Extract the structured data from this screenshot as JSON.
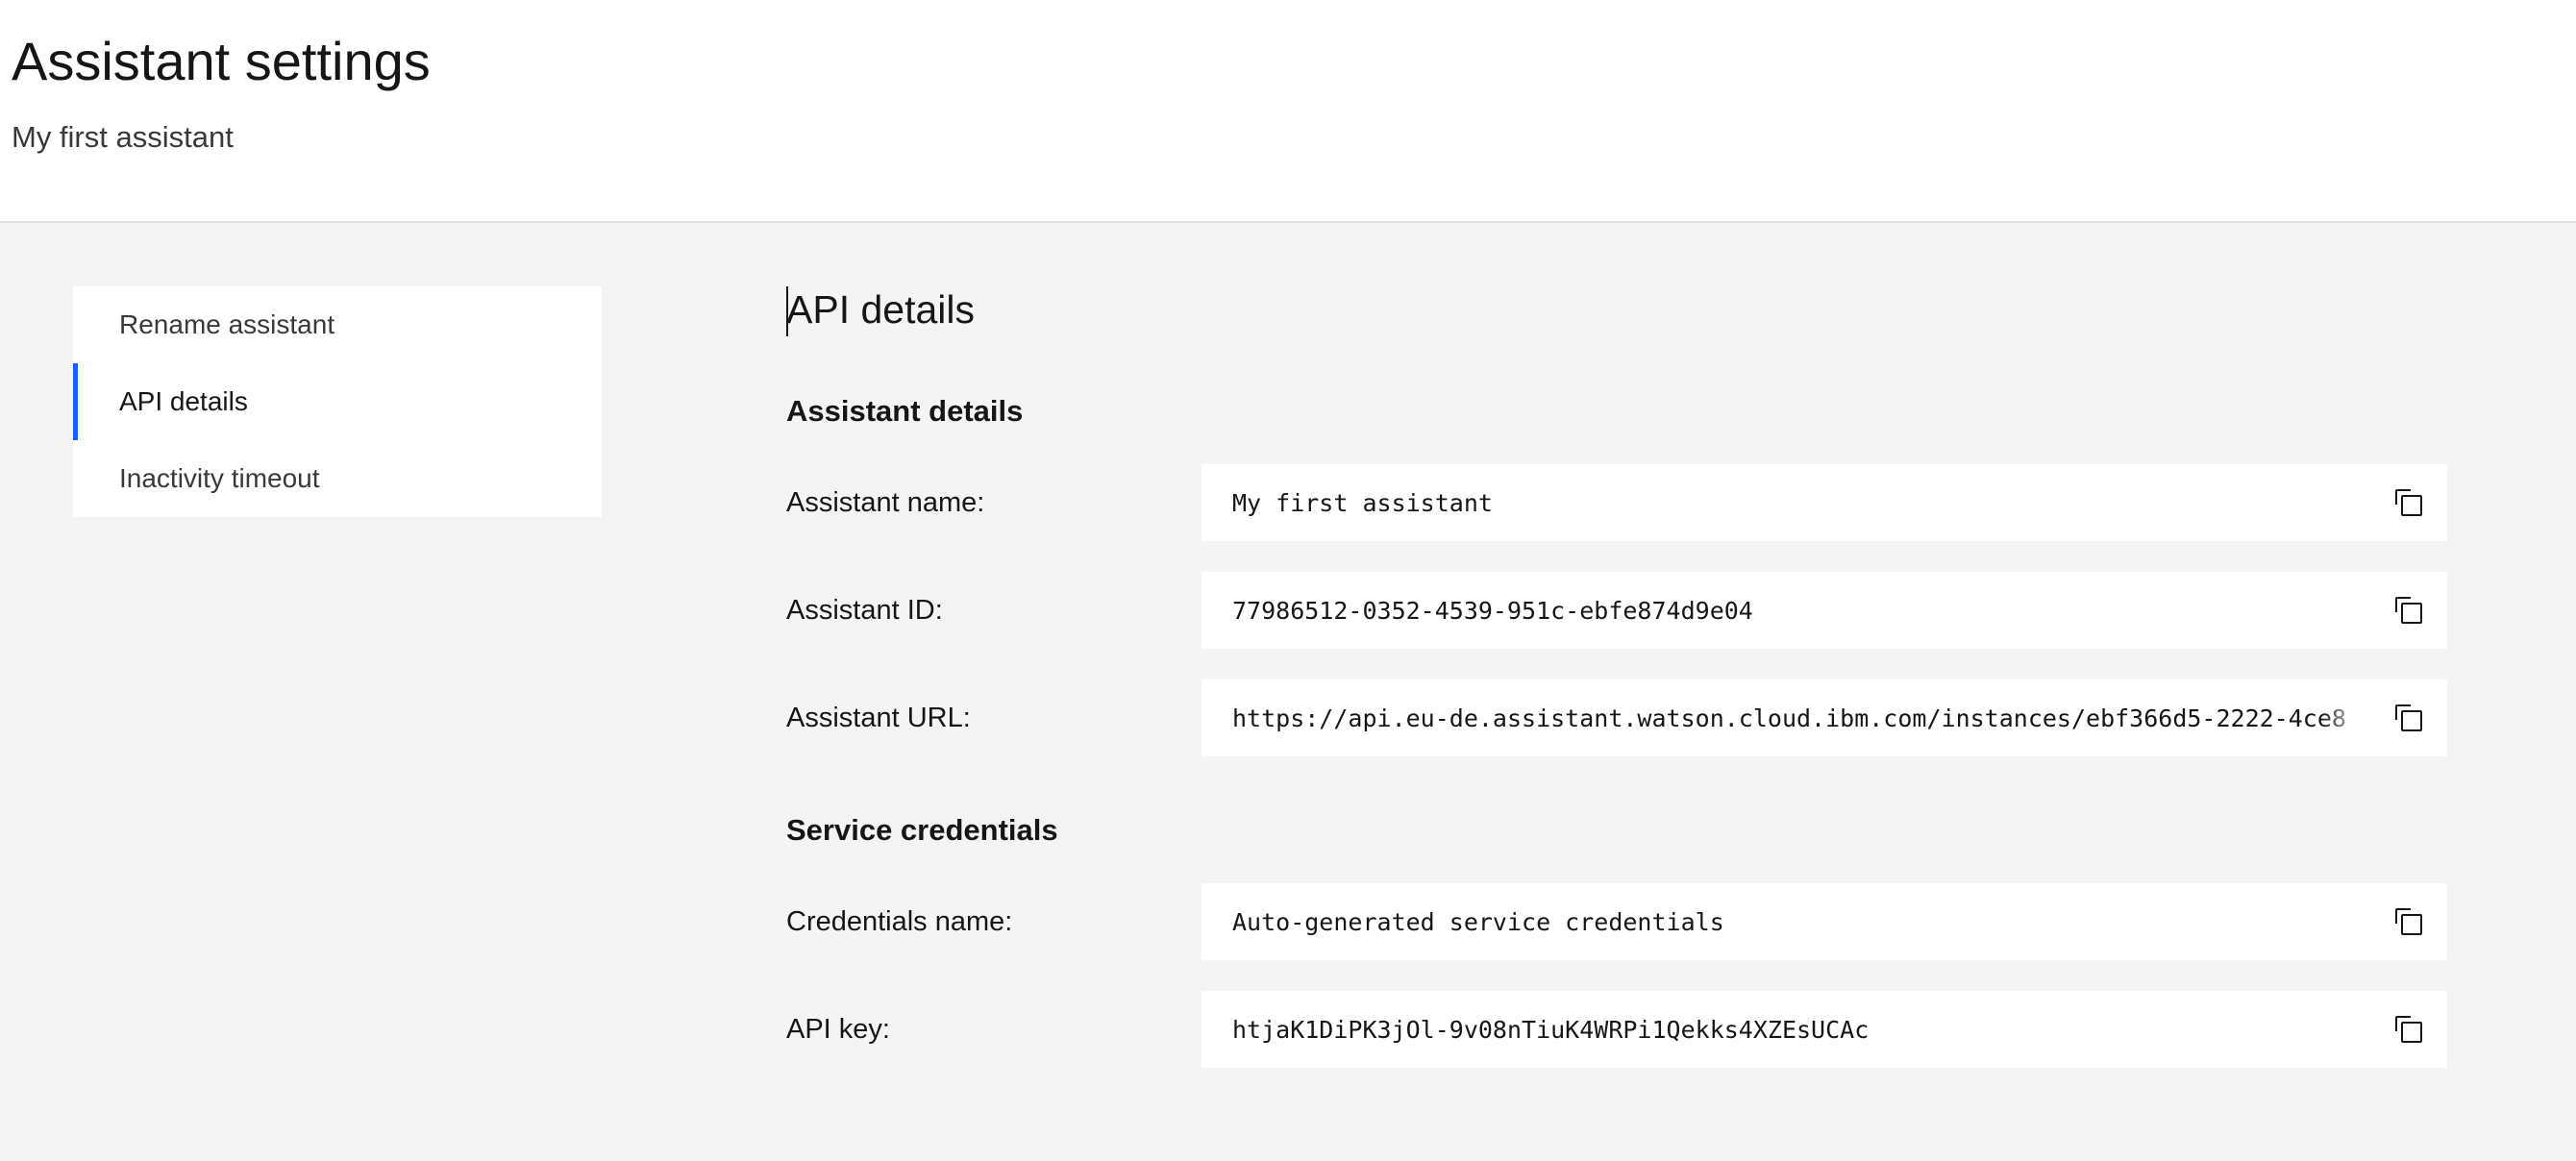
{
  "header": {
    "title": "Assistant settings",
    "subtitle": "My first assistant"
  },
  "side_nav": {
    "items": [
      {
        "label": "Rename assistant",
        "active": false
      },
      {
        "label": "API details",
        "active": true
      },
      {
        "label": "Inactivity timeout",
        "active": false
      }
    ]
  },
  "main": {
    "title": "API details",
    "assistant_details": {
      "heading": "Assistant details",
      "rows": [
        {
          "label": "Assistant name:",
          "value": "My first assistant"
        },
        {
          "label": "Assistant ID:",
          "value": "77986512-0352-4539-951c-ebfe874d9e04"
        },
        {
          "label": "Assistant URL:",
          "value": "https://api.eu-de.assistant.watson.cloud.ibm.com/instances/ebf366d5-2222-4ce8"
        }
      ]
    },
    "service_credentials": {
      "heading": "Service credentials",
      "rows": [
        {
          "label": "Credentials name:",
          "value": "Auto-generated service credentials"
        },
        {
          "label": "API key:",
          "value": "htjaK1DiPK3jOl-9v08nTiuK4WRPi1Qekks4XZEsUCAc"
        }
      ]
    },
    "copy_icon": "copy-icon"
  },
  "colors": {
    "accent": "#0f62fe",
    "background": "#f4f4f4",
    "surface": "#ffffff",
    "text": "#161616"
  }
}
